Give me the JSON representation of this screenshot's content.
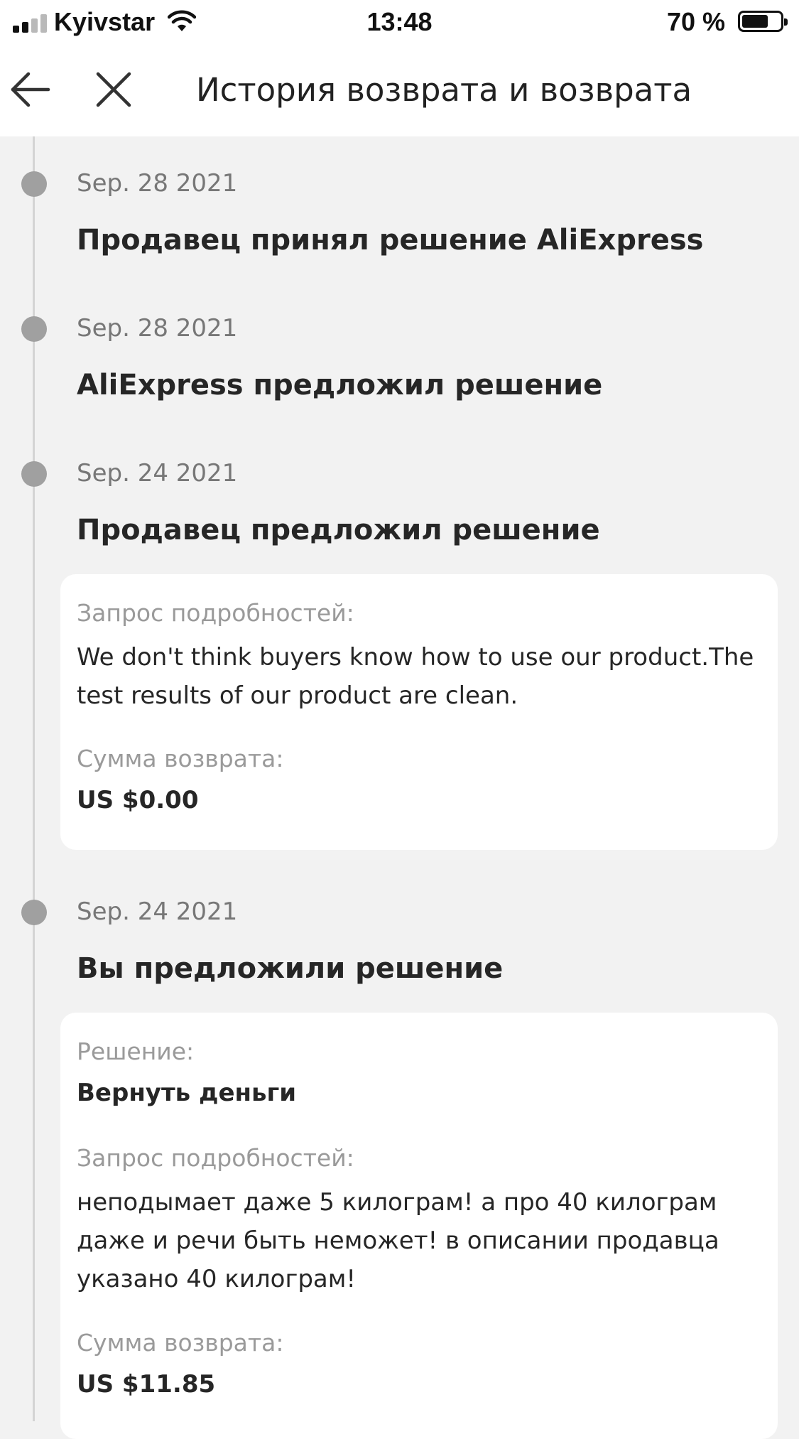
{
  "status_bar": {
    "carrier": "Kyivstar",
    "time": "13:48",
    "battery_percent": "70 %",
    "battery_level": 0.7
  },
  "nav": {
    "title": "История возврата и возврата",
    "back_icon": "arrow-left-icon",
    "close_icon": "close-icon"
  },
  "timeline": {
    "entries": [
      {
        "date": "Sep. 28 2021",
        "title": "Продавец принял решение AliExpress"
      },
      {
        "date": "Sep. 28 2021",
        "title": "AliExpress предложил решение"
      },
      {
        "date": "Sep. 24 2021",
        "title": "Продавец предложил решение",
        "details": {
          "request_label": "Запрос подробностей:",
          "request_text": "We don't think buyers know how to use our product.The test results of our product are clean.",
          "amount_label": "Сумма возврата:",
          "amount_value": "US $0.00"
        }
      },
      {
        "date": "Sep. 24 2021",
        "title": "Вы предложили решение",
        "details": {
          "solution_label": "Решение:",
          "solution_value": "Вернуть деньги",
          "request_label": "Запрос подробностей:",
          "request_text": "неподымает даже 5 килограм! а про 40 килограм даже и речи быть неможет! в описании продавца указано 40 килограм!",
          "amount_label": "Сумма возврата:",
          "amount_value": "US $11.85"
        }
      }
    ]
  },
  "colors": {
    "background": "#f2f2f2",
    "card": "#ffffff",
    "timeline_dot": "#a0a0a0",
    "timeline_line": "#d4d4d4",
    "muted_text": "#9a9a9a",
    "primary_text": "#262626"
  }
}
